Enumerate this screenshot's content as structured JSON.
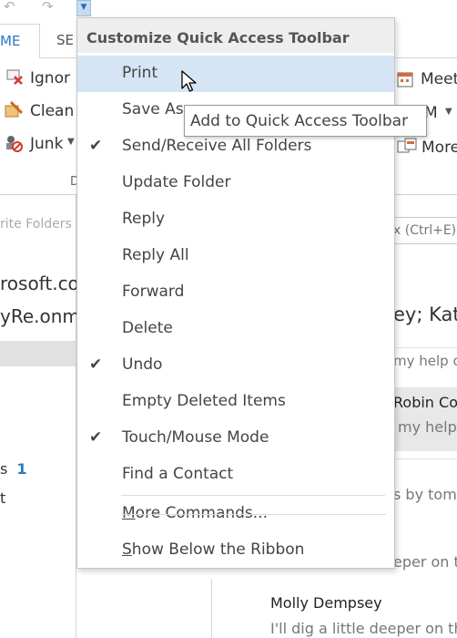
{
  "tabs": {
    "home": "ME",
    "send_receive": "SE"
  },
  "ribbon": {
    "ignore": "Ignor",
    "clean_up": "Clean",
    "junk": "Junk",
    "group_label": "D",
    "meeting": "Meet",
    "im": "M",
    "more": "More"
  },
  "folder_pane": {
    "favorites_search": "rite Folders",
    "account_1": "rosoft.co",
    "account_2": "yRe.onm",
    "folder_s": "s",
    "folder_s_count": "1",
    "folder_t": "t"
  },
  "reading": {
    "search": "x (Ctrl+E)",
    "recipients": "ey;  Kat",
    "preview_1": "my help o",
    "sender_1": "Robin Co",
    "preview_2": "my help",
    "preview_3": "s by tomo",
    "preview_4": "eper on th",
    "bottom_sender": "Molly Dempsey",
    "bottom_preview": "I'll dig a little deeper on th"
  },
  "menu": {
    "title": "Customize Quick Access Toolbar",
    "items": [
      {
        "label": "Print",
        "checked": false
      },
      {
        "label": "Save As",
        "checked": false
      },
      {
        "label": "Send/Receive All Folders",
        "checked": true
      },
      {
        "label": "Update Folder",
        "checked": false
      },
      {
        "label": "Reply",
        "checked": false
      },
      {
        "label": "Reply All",
        "checked": false
      },
      {
        "label": "Forward",
        "checked": false
      },
      {
        "label": "Delete",
        "checked": false
      },
      {
        "label": "Undo",
        "checked": true
      },
      {
        "label": "Empty Deleted Items",
        "checked": false
      },
      {
        "label": "Touch/Mouse Mode",
        "checked": true
      },
      {
        "label": "Find a Contact",
        "checked": false
      }
    ],
    "more_commands": {
      "key": "M",
      "rest": "ore Commands..."
    },
    "show_below": {
      "key": "S",
      "rest": "how Below the Ribbon"
    },
    "check_glyph": "✔"
  },
  "tooltip": "Add to Quick Access Toolbar",
  "colors": {
    "accent": "#2b79c2",
    "hover": "#d5e5f5",
    "header_bg": "#eeeeee"
  }
}
